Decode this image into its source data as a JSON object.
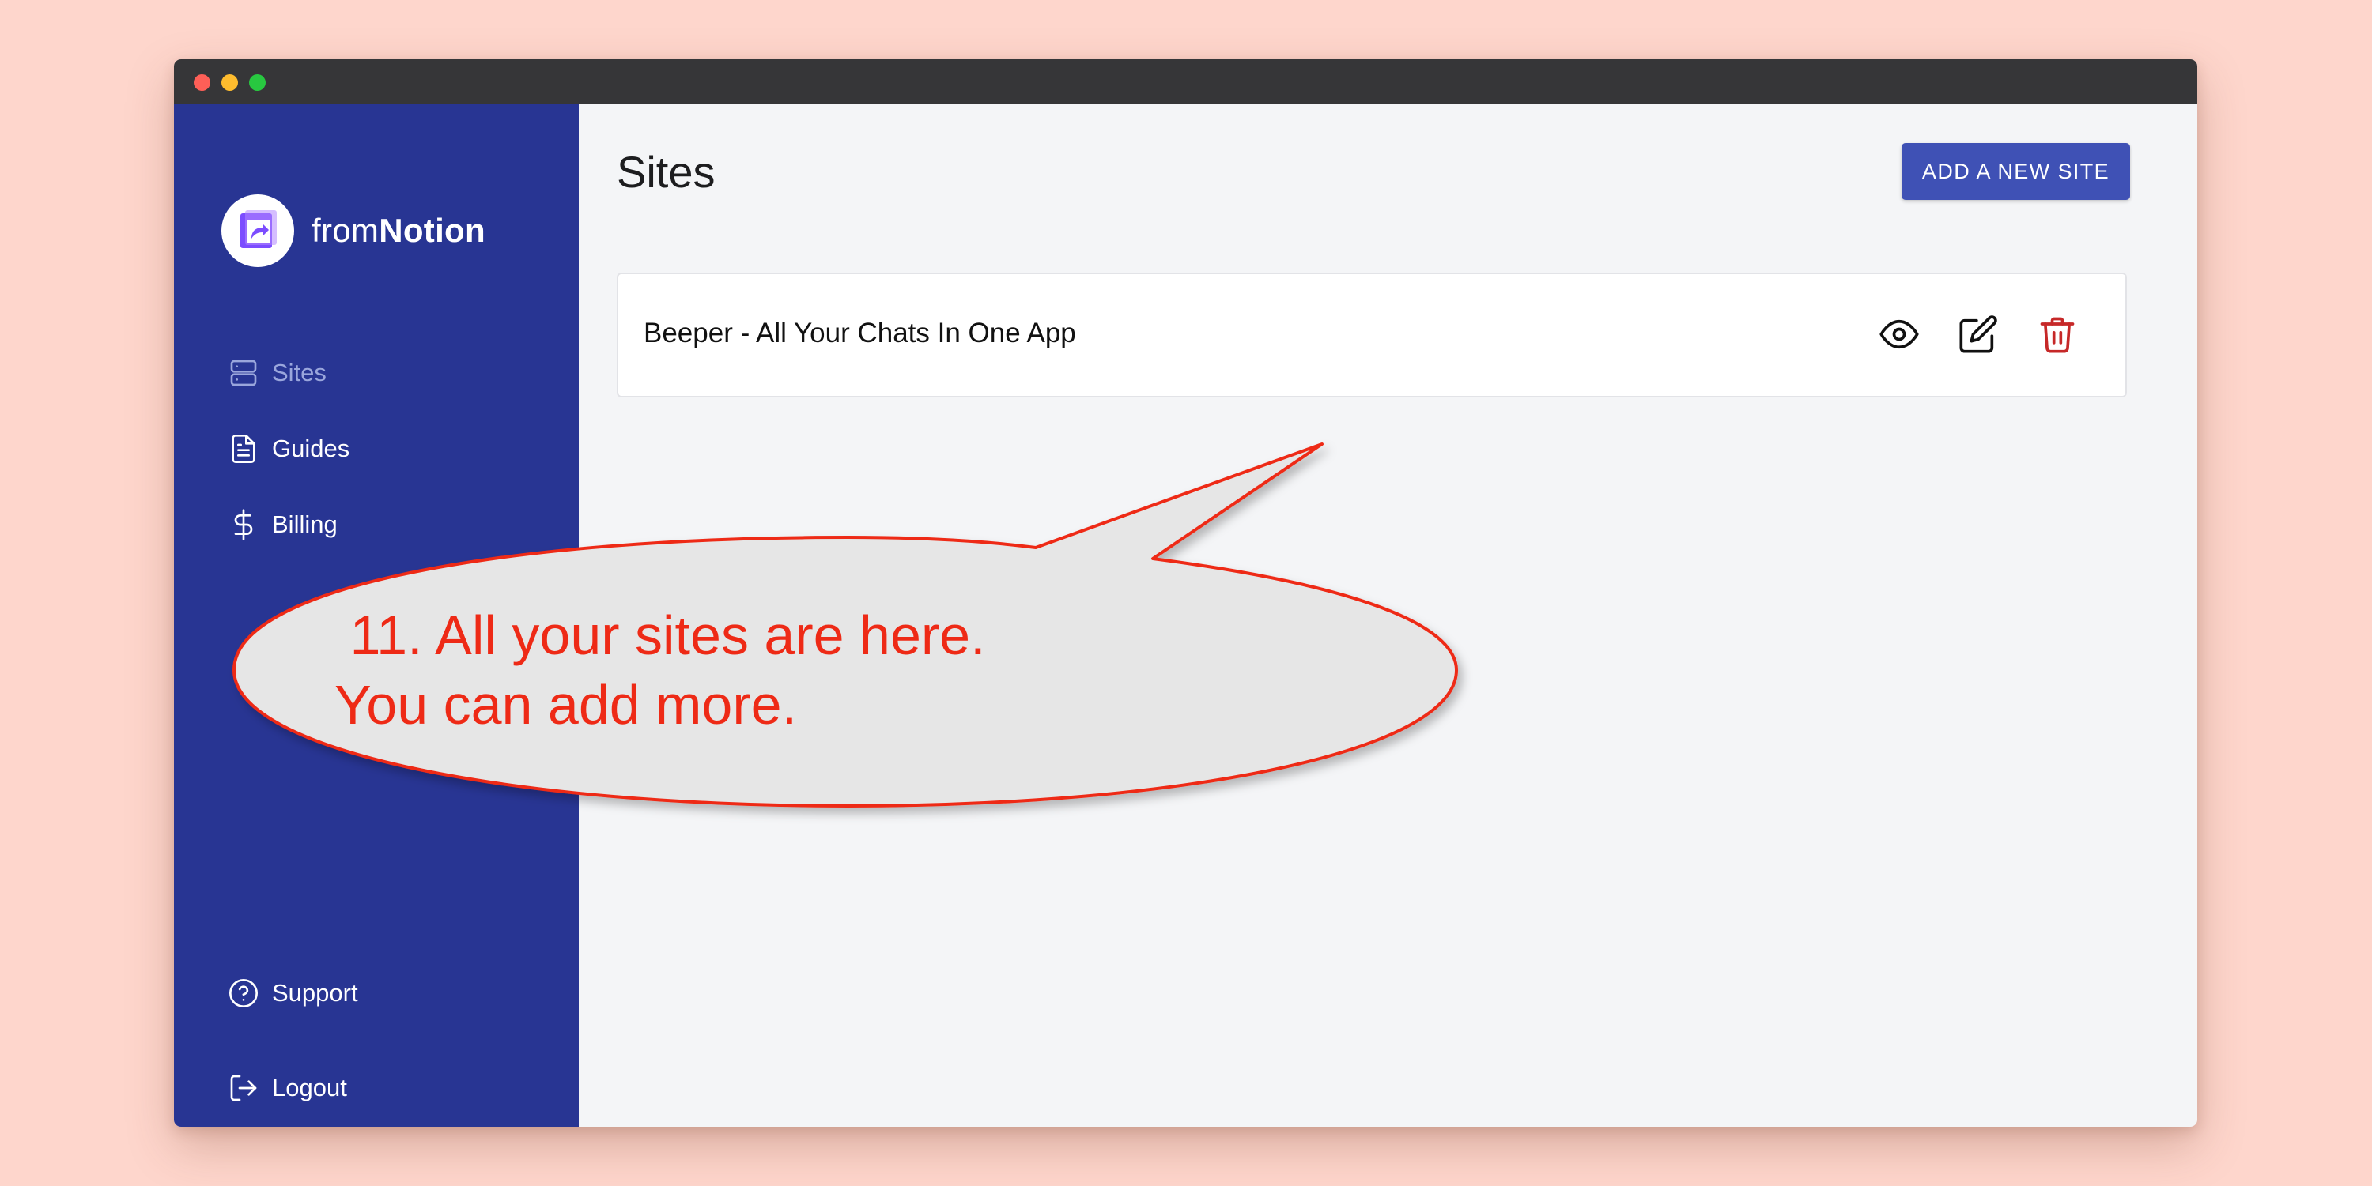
{
  "brand": {
    "prefix": "from",
    "bold": "Notion"
  },
  "sidebar": {
    "items": [
      {
        "label": "Sites",
        "icon": "server-icon",
        "active": true
      },
      {
        "label": "Guides",
        "icon": "document-icon",
        "active": false
      },
      {
        "label": "Billing",
        "icon": "dollar-icon",
        "active": false
      }
    ],
    "bottom_items": [
      {
        "label": "Support",
        "icon": "question-circle-icon"
      },
      {
        "label": "Logout",
        "icon": "logout-icon"
      }
    ]
  },
  "main": {
    "title": "Sites",
    "add_button_label": "ADD A NEW SITE",
    "sites": [
      {
        "name": "Beeper - All Your Chats In One App",
        "actions": [
          "eye-icon",
          "edit-icon",
          "trash-icon"
        ]
      }
    ]
  },
  "callout": {
    "line1": " 11. All your sites are here.",
    "line2": "You can add more."
  },
  "colors": {
    "background": "#fed6cc",
    "sidebar": "#283593",
    "accent": "#3f51b5",
    "active_nav": "#9aa6dc",
    "delete": "#c62828",
    "callout_text": "#ee2a16",
    "callout_fill": "#e6e6e6"
  }
}
